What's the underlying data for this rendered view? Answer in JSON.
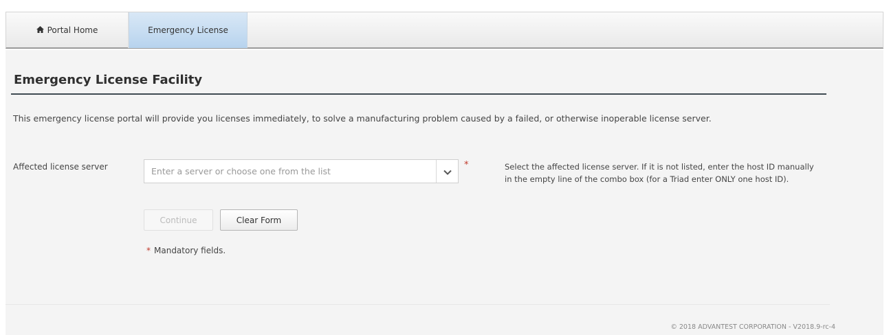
{
  "nav": {
    "home_icon": "home-icon",
    "home_label": "Portal Home",
    "active_tab_label": "Emergency License"
  },
  "page": {
    "title": "Emergency License Facility",
    "intro": "This emergency license portal will provide you licenses immediately, to solve a manufacturing problem caused by a failed, or otherwise inoperable license server."
  },
  "form": {
    "server_label": "Affected license server",
    "server_placeholder": "Enter a server or choose one from the list",
    "server_value": "",
    "required_marker": "*",
    "help_line1": "Select the affected license server. If it is not listed, enter the host ID manually",
    "help_line2": "in the empty line of the combo box (for a Triad enter ONLY one host ID).",
    "continue_label": "Continue",
    "clear_label": "Clear Form",
    "mandatory_note": "Mandatory fields."
  },
  "footer": {
    "text": "© 2018 ADVANTEST CORPORATION - V2018.9-rc-4"
  },
  "colors": {
    "active_tab": "#c5dcf1",
    "title_rule": "#3f4a52",
    "required": "#c0392b"
  }
}
